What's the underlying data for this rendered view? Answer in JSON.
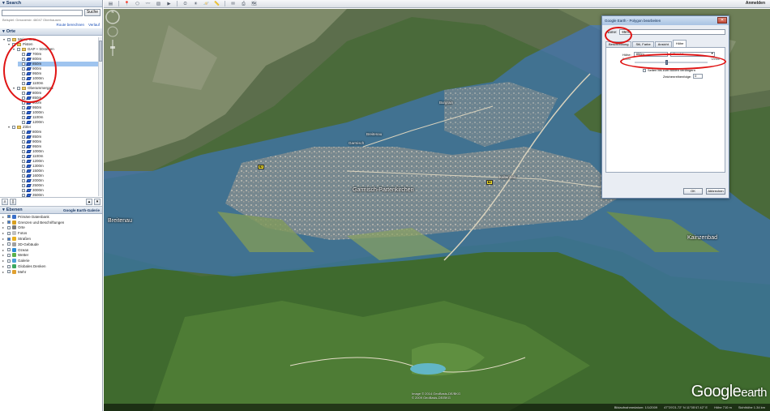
{
  "search": {
    "title": "Search",
    "button": "Suche",
    "hint": "Beispiel: Gessnerstr. 46047 Oberhausen",
    "link_route": "Route berechnen",
    "link_history": "Verlauf"
  },
  "places": {
    "title": "Orte",
    "tree": [
      {
        "label": "Meine Orte",
        "kind": "folder",
        "depth": 0,
        "exp": "▾"
      },
      {
        "label": "Pisten",
        "kind": "folder",
        "depth": 1,
        "exp": "▾"
      },
      {
        "label": "GAP + 50stesen",
        "kind": "folder",
        "depth": 2,
        "exp": "▾"
      },
      {
        "label": "700m",
        "kind": "poly",
        "depth": 3
      },
      {
        "label": "800m",
        "kind": "poly",
        "depth": 3
      },
      {
        "label": "850m",
        "kind": "poly",
        "depth": 3,
        "selected": true
      },
      {
        "label": "900m",
        "kind": "poly",
        "depth": 3
      },
      {
        "label": "950m",
        "kind": "poly",
        "depth": 3
      },
      {
        "label": "1000m",
        "kind": "poly",
        "depth": 3
      },
      {
        "label": "1100m",
        "kind": "poly",
        "depth": 3
      },
      {
        "label": "Oberammergau",
        "kind": "folder",
        "depth": 2,
        "exp": "▾"
      },
      {
        "label": "800m",
        "kind": "poly",
        "depth": 3
      },
      {
        "label": "850m",
        "kind": "poly",
        "depth": 3
      },
      {
        "label": "900m",
        "kind": "poly",
        "depth": 3
      },
      {
        "label": "950m",
        "kind": "poly",
        "depth": 3
      },
      {
        "label": "1000m",
        "kind": "poly",
        "depth": 3
      },
      {
        "label": "1100m",
        "kind": "poly",
        "depth": 3
      },
      {
        "label": "1200m",
        "kind": "poly",
        "depth": 3
      },
      {
        "label": "Zirler",
        "kind": "folder",
        "depth": 1,
        "exp": "▾"
      },
      {
        "label": "800m",
        "kind": "poly",
        "depth": 3
      },
      {
        "label": "850m",
        "kind": "poly",
        "depth": 3
      },
      {
        "label": "900m",
        "kind": "poly",
        "depth": 3
      },
      {
        "label": "950m",
        "kind": "poly",
        "depth": 3
      },
      {
        "label": "1000m",
        "kind": "poly",
        "depth": 3
      },
      {
        "label": "1100m",
        "kind": "poly",
        "depth": 3
      },
      {
        "label": "1200m",
        "kind": "poly",
        "depth": 3
      },
      {
        "label": "1300m",
        "kind": "poly",
        "depth": 3
      },
      {
        "label": "1500m",
        "kind": "poly",
        "depth": 3
      },
      {
        "label": "1600m",
        "kind": "poly",
        "depth": 3
      },
      {
        "label": "2000m",
        "kind": "poly",
        "depth": 3
      },
      {
        "label": "2500m",
        "kind": "poly",
        "depth": 3
      },
      {
        "label": "3000m",
        "kind": "poly",
        "depth": 3
      },
      {
        "label": "3500m",
        "kind": "poly",
        "depth": 3
      }
    ]
  },
  "layers": {
    "title": "Ebenen",
    "gallery": "Google Earth-Galerie",
    "items": [
      {
        "label": "Primäre Datenbank",
        "color": "#3a6fc9",
        "on": true
      },
      {
        "label": "Grenzen und Beschriftungen",
        "color": "#d8a020",
        "on": true
      },
      {
        "label": "Orte",
        "color": "#7a7a7a",
        "on": false
      },
      {
        "label": "Fotos",
        "color": "#c0c0c0",
        "on": false
      },
      {
        "label": "Straßen",
        "color": "#e8b020",
        "on": true
      },
      {
        "label": "3D-Gebäude",
        "color": "#a0a0a0",
        "on": false
      },
      {
        "label": "Ozean",
        "color": "#2b8bd6",
        "on": false
      },
      {
        "label": "Wetter",
        "color": "#5ab04a",
        "on": false
      },
      {
        "label": "Galerie",
        "color": "#4aa0d8",
        "on": false
      },
      {
        "label": "Globales Denken",
        "color": "#3aa860",
        "on": false
      },
      {
        "label": "Mehr",
        "color": "#e0a030",
        "on": false
      }
    ]
  },
  "toolbar": {
    "icons": [
      "sidebar-icon",
      "placemark-icon",
      "polygon-icon",
      "path-icon",
      "overlay-icon",
      "tour-icon",
      "history-icon",
      "sun-icon",
      "planet-icon",
      "ruler-icon",
      "email-icon",
      "print-icon",
      "maps-icon"
    ],
    "glyphs": [
      "▤",
      "📍",
      "⬠",
      "〰",
      "▧",
      "▶",
      "⏲",
      "☀",
      "🪐",
      "📏",
      "✉",
      "⎙",
      "🗺"
    ],
    "sign_in": "Anmelden"
  },
  "map": {
    "labels": [
      {
        "text": "Garmisch-Partenkirchen",
        "cls": "place"
      },
      {
        "text": "Burgrain",
        "cls": "place small"
      },
      {
        "text": "Breitenau",
        "cls": "place small"
      },
      {
        "text": "Kaltenbad",
        "cls": "place small"
      },
      {
        "text": "Kainzenbad",
        "cls": "place"
      },
      {
        "text": "Breitenau",
        "cls": "place"
      },
      {
        "text": "Garmisch",
        "cls": "place small"
      }
    ],
    "badges": [
      "B2",
      "B2"
    ],
    "copyright": "Image © 2014 GeoBasis-DE/BKG\n© 2009 GeoBasis-DE/BKG",
    "status": [
      "Bildaufnahmedatum: 1/1/2009",
      "47°29'21.72\" N  11°05'47.42\" E",
      "Höhe 710 m",
      "Sichthöhe 1.34 km"
    ],
    "logo_google": "Google",
    "logo_earth": "earth"
  },
  "dialog": {
    "title": "Google Earth - Polygon bearbeiten",
    "close": "✕",
    "name_label": "Name:",
    "name_value": "850m",
    "tabs": [
      "Beschreibung",
      "Stil, Farbe",
      "Ansicht",
      "Höhe"
    ],
    "active_tab": 3,
    "alt_label": "Höhe:",
    "alt_value": "850m",
    "alt_mode": "Absolut",
    "slider_left": "Boden",
    "slider_right": "Weltall",
    "extend_label": "Seiten bis zum Boden verlängern",
    "order_label": "Zeichenreihenfolge:",
    "order_value": "0",
    "ok": "OK",
    "cancel": "Abbrechen"
  },
  "colors": {
    "overlay_blue": "#3a78d8",
    "annotation_red": "#e01414"
  }
}
